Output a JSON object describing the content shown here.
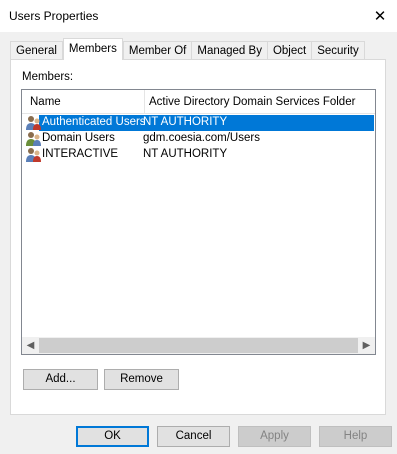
{
  "window": {
    "title": "Users Properties"
  },
  "tabs": [
    {
      "label": "General"
    },
    {
      "label": "Members"
    },
    {
      "label": "Member Of"
    },
    {
      "label": "Managed By"
    },
    {
      "label": "Object"
    },
    {
      "label": "Security"
    }
  ],
  "active_tab": "Members",
  "members": {
    "label": "Members:",
    "columns": [
      "Name",
      "Active Directory Domain Services Folder"
    ],
    "rows": [
      {
        "name": "Authenticated Users",
        "folder": "NT AUTHORITY",
        "icon": "special-group-icon",
        "selected": true
      },
      {
        "name": "Domain Users",
        "folder": "gdm.coesia.com/Users",
        "icon": "group-icon",
        "selected": false
      },
      {
        "name": "INTERACTIVE",
        "folder": "NT AUTHORITY",
        "icon": "special-group-icon",
        "selected": false
      }
    ],
    "add_label": "Add...",
    "remove_label": "Remove"
  },
  "dialog_buttons": {
    "ok": "OK",
    "cancel": "Cancel",
    "apply": "Apply",
    "help": "Help"
  },
  "colors": {
    "selection": "#0078d7",
    "background": "#f0f0f0"
  }
}
